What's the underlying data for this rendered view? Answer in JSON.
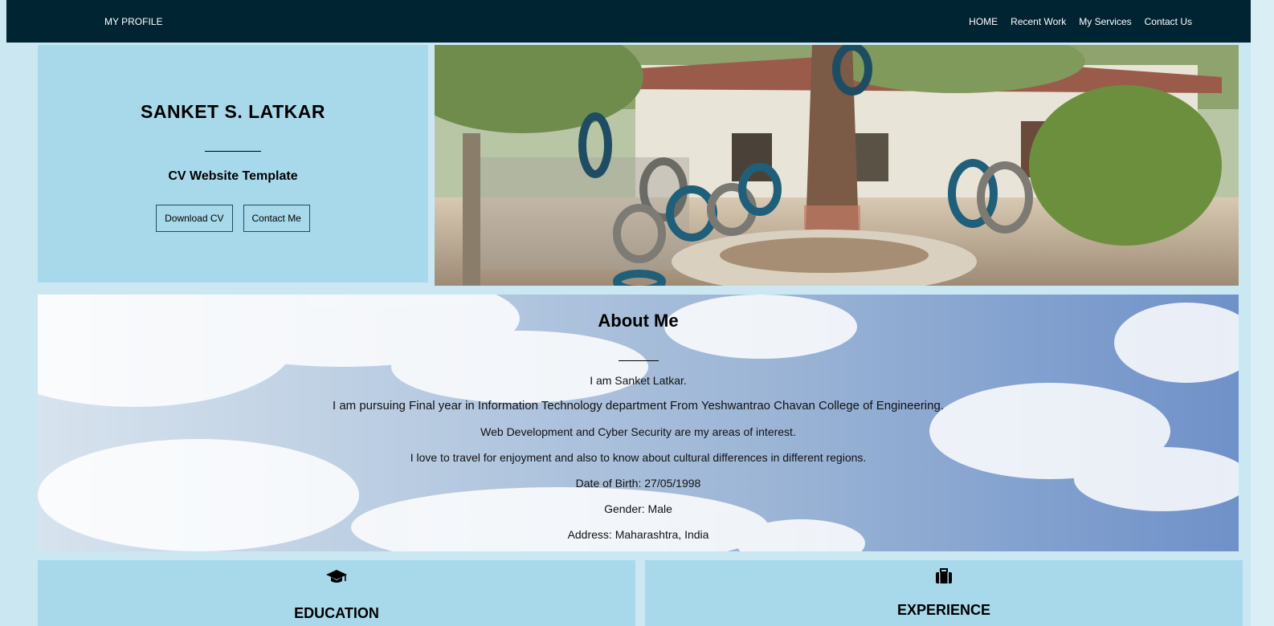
{
  "nav": {
    "brand": "MY PROFILE",
    "links": [
      "HOME",
      "Recent Work",
      "My Services",
      "Contact Us"
    ],
    "bg_color": "#012433"
  },
  "hero": {
    "name": "SANKET S. LATKAR",
    "subtitle": "CV Website Template",
    "download_label": "Download CV",
    "contact_label": "Contact Me",
    "panel_color": "#a8d9ea"
  },
  "about": {
    "title": "About Me",
    "lines": [
      "I am Sanket Latkar.",
      "I am pursuing Final year in Information Technology department From Yeshwantrao Chavan College of Engineering.",
      "Web Development and Cyber Security are my areas of interest.",
      "I love to travel for enjoyment and also to know about cultural differences in different regions.",
      "Date of Birth: 27/05/1998",
      "Gender: Male",
      "Address: Maharashtra, India"
    ]
  },
  "cards": {
    "education": {
      "title": "EDUCATION",
      "icon": "graduation-cap-icon"
    },
    "experience": {
      "title": "EXPERIENCE",
      "icon": "briefcase-icon"
    }
  }
}
